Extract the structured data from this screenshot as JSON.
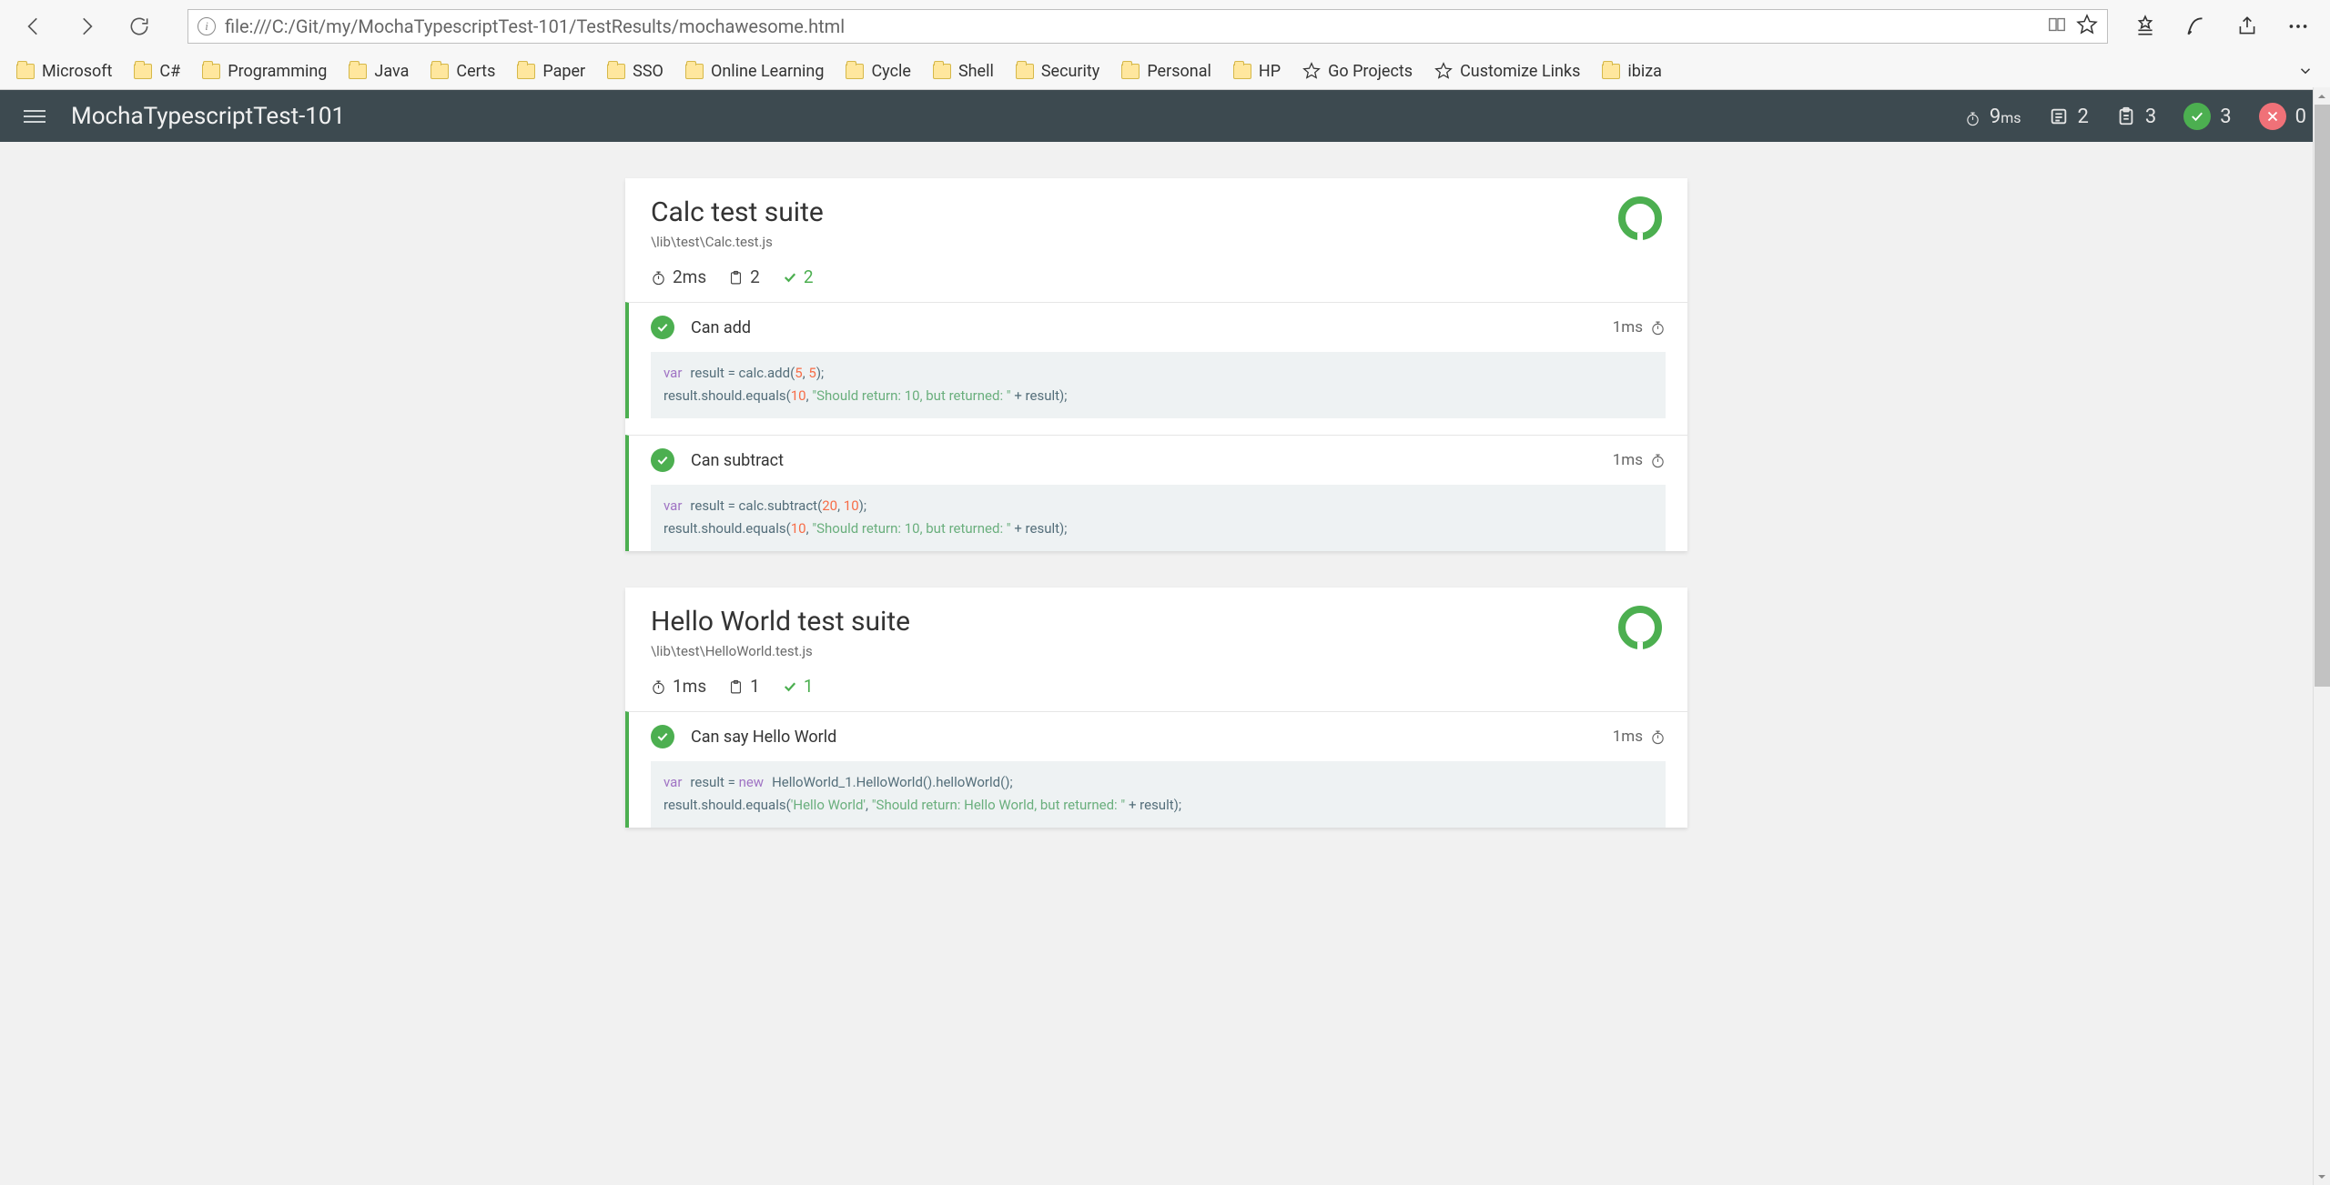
{
  "browser": {
    "url": "file:///C:/Git/my/MochaTypescriptTest-101/TestResults/mochawesome.html",
    "bookmarks": [
      {
        "label": "Microsoft",
        "type": "folder"
      },
      {
        "label": "C#",
        "type": "folder"
      },
      {
        "label": "Programming",
        "type": "folder"
      },
      {
        "label": "Java",
        "type": "folder"
      },
      {
        "label": "Certs",
        "type": "folder"
      },
      {
        "label": "Paper",
        "type": "folder"
      },
      {
        "label": "SSO",
        "type": "folder"
      },
      {
        "label": "Online Learning",
        "type": "folder"
      },
      {
        "label": "Cycle",
        "type": "folder"
      },
      {
        "label": "Shell",
        "type": "folder"
      },
      {
        "label": "Security",
        "type": "folder"
      },
      {
        "label": "Personal",
        "type": "folder"
      },
      {
        "label": "HP",
        "type": "folder"
      },
      {
        "label": "Go Projects",
        "type": "star"
      },
      {
        "label": "Customize Links",
        "type": "star"
      },
      {
        "label": "ibiza",
        "type": "folder"
      }
    ]
  },
  "report": {
    "title": "MochaTypescriptTest-101",
    "duration_value": "9",
    "duration_unit": "ms",
    "suites_count": "2",
    "tests_count": "3",
    "passes_count": "3",
    "failures_count": "0"
  },
  "suites": [
    {
      "title": "Calc test suite",
      "file": "\\lib\\test\\Calc.test.js",
      "duration": "2ms",
      "test_count": "2",
      "pass_count": "2",
      "tests": [
        {
          "name": "Can add",
          "duration": "1ms",
          "code_tokens": [
            {
              "t": "kw",
              "v": "var"
            },
            {
              "t": "sp",
              "v": " "
            },
            {
              "t": "var",
              "v": "result = calc.add("
            },
            {
              "t": "num",
              "v": "5"
            },
            {
              "t": "var",
              "v": ", "
            },
            {
              "t": "num",
              "v": "5"
            },
            {
              "t": "var",
              "v": ");"
            },
            {
              "t": "br"
            },
            {
              "t": "var",
              "v": "result.should.equals("
            },
            {
              "t": "num",
              "v": "10"
            },
            {
              "t": "var",
              "v": ", "
            },
            {
              "t": "str",
              "v": "\"Should return: 10, but returned: \""
            },
            {
              "t": "var",
              "v": " + result);"
            }
          ]
        },
        {
          "name": "Can subtract",
          "duration": "1ms",
          "code_tokens": [
            {
              "t": "kw",
              "v": "var"
            },
            {
              "t": "sp",
              "v": " "
            },
            {
              "t": "var",
              "v": "result = calc.subtract("
            },
            {
              "t": "num",
              "v": "20"
            },
            {
              "t": "var",
              "v": ", "
            },
            {
              "t": "num",
              "v": "10"
            },
            {
              "t": "var",
              "v": ");"
            },
            {
              "t": "br"
            },
            {
              "t": "var",
              "v": "result.should.equals("
            },
            {
              "t": "num",
              "v": "10"
            },
            {
              "t": "var",
              "v": ", "
            },
            {
              "t": "str",
              "v": "\"Should return: 10, but returned: \""
            },
            {
              "t": "var",
              "v": " + result);"
            }
          ]
        }
      ]
    },
    {
      "title": "Hello World test suite",
      "file": "\\lib\\test\\HelloWorld.test.js",
      "duration": "1ms",
      "test_count": "1",
      "pass_count": "1",
      "tests": [
        {
          "name": "Can say Hello World",
          "duration": "1ms",
          "code_tokens": [
            {
              "t": "kw",
              "v": "var"
            },
            {
              "t": "sp",
              "v": " "
            },
            {
              "t": "var",
              "v": "result = "
            },
            {
              "t": "kw",
              "v": "new"
            },
            {
              "t": "sp",
              "v": " "
            },
            {
              "t": "var",
              "v": "HelloWorld_1.HelloWorld().helloWorld();"
            },
            {
              "t": "br"
            },
            {
              "t": "var",
              "v": "result.should.equals("
            },
            {
              "t": "str",
              "v": "'Hello World'"
            },
            {
              "t": "var",
              "v": ", "
            },
            {
              "t": "str",
              "v": "\"Should return: Hello World, but returned: \""
            },
            {
              "t": "var",
              "v": " + result);"
            }
          ]
        }
      ]
    }
  ]
}
